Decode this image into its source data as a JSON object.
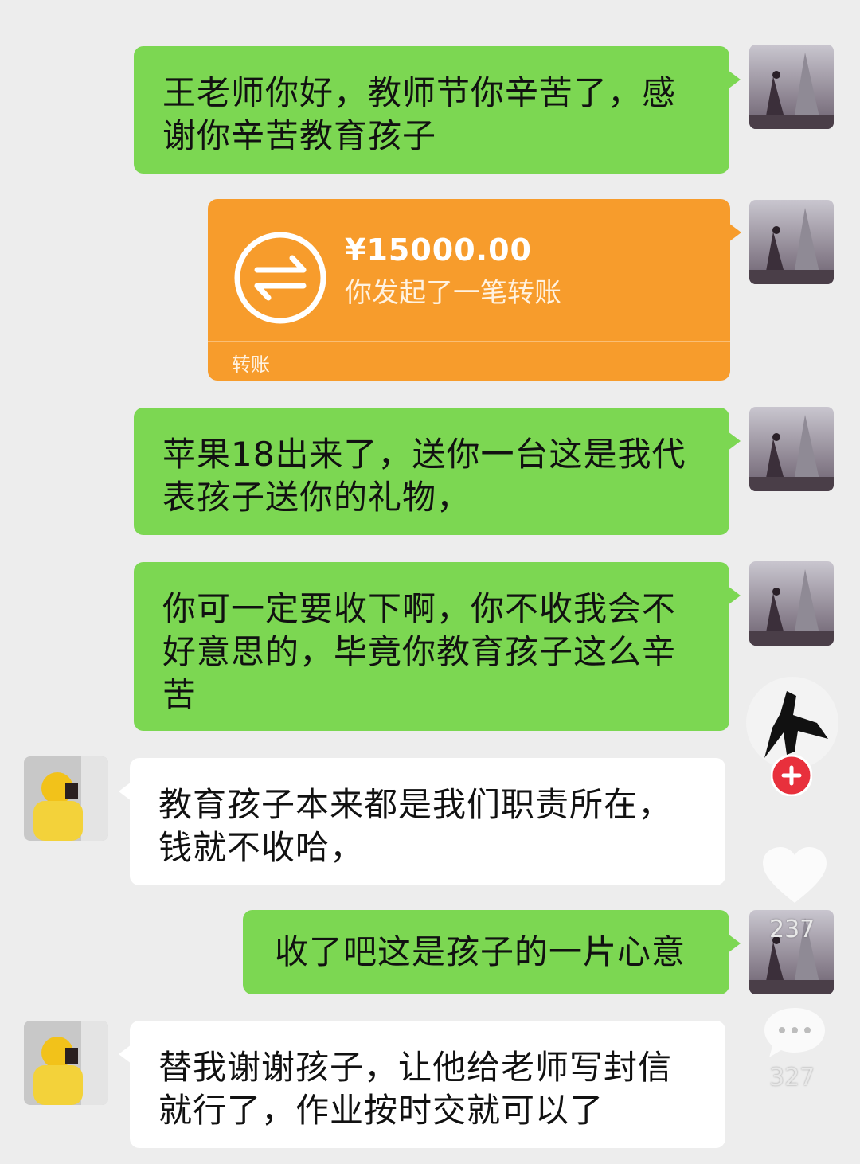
{
  "messages": [
    {
      "side": "right",
      "type": "text",
      "text": "王老师你好，教师节你辛苦了，感谢你辛苦教育孩子"
    },
    {
      "side": "right",
      "type": "transfer",
      "amount": "¥15000.00",
      "desc": "你发起了一笔转账",
      "tag": "转账"
    },
    {
      "side": "right",
      "type": "text",
      "text": "苹果18出来了，送你一台这是我代表孩子送你的礼物，"
    },
    {
      "side": "right",
      "type": "text",
      "text": "你可一定要收下啊，你不收我会不好意思的，毕竟你教育孩子这么辛苦"
    },
    {
      "side": "left",
      "type": "text",
      "text": "教育孩子本来都是我们职责所在，钱就不收哈，"
    },
    {
      "side": "right",
      "type": "text",
      "text": "收了吧这是孩子的一片心意"
    },
    {
      "side": "left",
      "type": "text",
      "text": "替我谢谢孩子，让他给老师写封信就行了，作业按时交就可以了"
    }
  ],
  "overlay": {
    "like_count": "237",
    "comment_count": "327",
    "follow_icon": "plus-icon",
    "colors": {
      "green_bubble": "#7cd752",
      "transfer": "#f79c2c",
      "follow": "#e8303c"
    }
  }
}
